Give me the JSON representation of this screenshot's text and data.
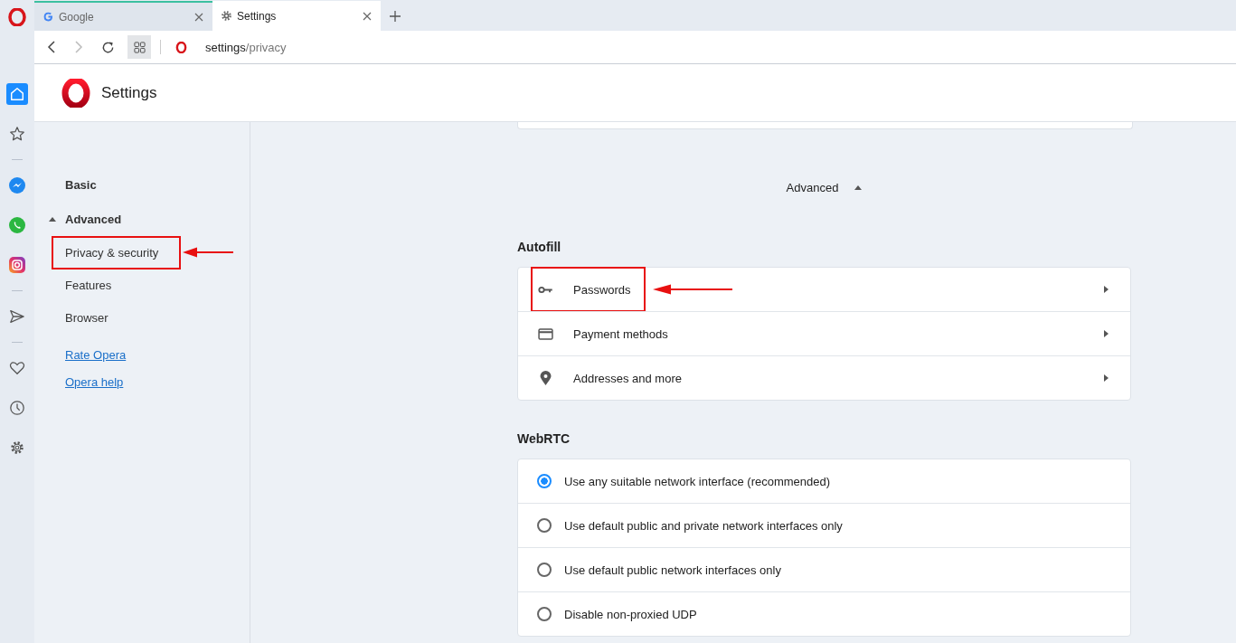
{
  "browser_tabs": [
    {
      "label": "Google",
      "kind": "google",
      "selected": false
    },
    {
      "label": "Settings",
      "kind": "gear",
      "selected": true
    }
  ],
  "address_bar": {
    "host": "settings",
    "path": "/privacy"
  },
  "sidebar": [
    {
      "kind": "home",
      "selected": true
    },
    {
      "kind": "star",
      "selected": false
    },
    {
      "kind": "divider"
    },
    {
      "kind": "messenger",
      "selected": false
    },
    {
      "kind": "whatsapp",
      "selected": false
    },
    {
      "kind": "instagram",
      "selected": false
    },
    {
      "kind": "divider"
    },
    {
      "kind": "send",
      "selected": false
    },
    {
      "kind": "divider"
    },
    {
      "kind": "heart",
      "selected": false
    },
    {
      "kind": "clock",
      "selected": false
    },
    {
      "kind": "gear",
      "selected": false
    }
  ],
  "page_title": "Settings",
  "nav": {
    "items": [
      {
        "label": "Basic",
        "kind": "section",
        "annotated": false
      },
      {
        "label": "Advanced",
        "kind": "section",
        "expanded": true,
        "annotated": false
      },
      {
        "label": "Privacy & security",
        "kind": "item",
        "annotated": true
      },
      {
        "label": "Features",
        "kind": "item",
        "annotated": false
      },
      {
        "label": "Browser",
        "kind": "item",
        "annotated": false
      }
    ],
    "links": [
      "Rate Opera",
      "Opera help"
    ]
  },
  "advanced_toggle": {
    "label": "Advanced",
    "expanded": true
  },
  "autofill": {
    "title": "Autofill",
    "rows": [
      {
        "label": "Passwords",
        "kind": "key",
        "annotated": true
      },
      {
        "label": "Payment methods",
        "kind": "card",
        "annotated": false
      },
      {
        "label": "Addresses and more",
        "kind": "pin",
        "annotated": false
      }
    ]
  },
  "webrtc": {
    "title": "WebRTC",
    "options": [
      {
        "label": "Use any suitable network interface (recommended)",
        "selected": true
      },
      {
        "label": "Use default public and private network interfaces only",
        "selected": false
      },
      {
        "label": "Use default public network interfaces only",
        "selected": false
      },
      {
        "label": "Disable non-proxied UDP",
        "selected": false
      }
    ]
  }
}
